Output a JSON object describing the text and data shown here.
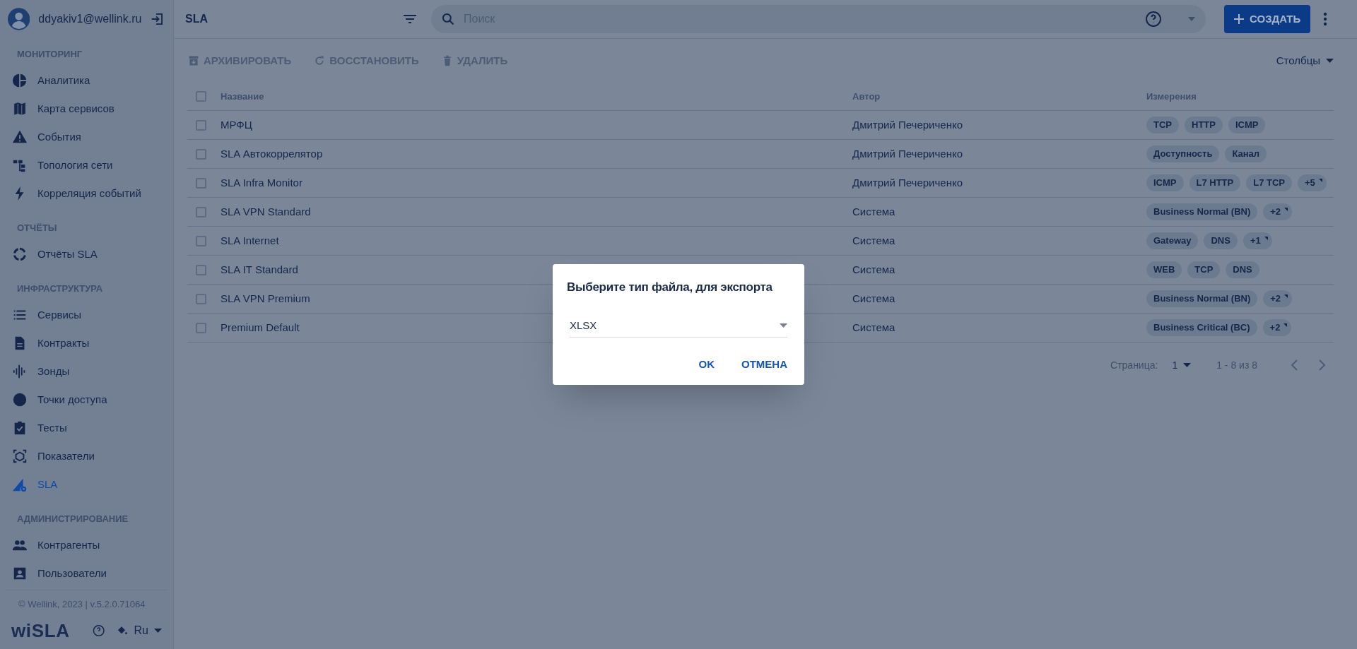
{
  "user": {
    "email": "ddyakiv1@wellink.ru"
  },
  "sidebar": {
    "sections": [
      {
        "heading": "МОНИТОРИНГ",
        "items": [
          {
            "label": "Аналитика",
            "selected": false
          },
          {
            "label": "Карта сервисов",
            "selected": false
          },
          {
            "label": "События",
            "selected": false
          },
          {
            "label": "Топология сети",
            "selected": false
          },
          {
            "label": "Корреляция событий",
            "selected": false
          }
        ]
      },
      {
        "heading": "ОТЧЁТЫ",
        "items": [
          {
            "label": "Отчёты SLA",
            "selected": false
          }
        ]
      },
      {
        "heading": "ИНФРАСТРУКТУРА",
        "items": [
          {
            "label": "Сервисы",
            "selected": false
          },
          {
            "label": "Контракты",
            "selected": false
          },
          {
            "label": "Зонды",
            "selected": false
          },
          {
            "label": "Точки доступа",
            "selected": false
          },
          {
            "label": "Тесты",
            "selected": false
          },
          {
            "label": "Показатели",
            "selected": false
          },
          {
            "label": "SLA",
            "selected": true
          }
        ]
      },
      {
        "heading": "АДМИНИСТРИРОВАНИЕ",
        "items": [
          {
            "label": "Контрагенты",
            "selected": false
          },
          {
            "label": "Пользователи",
            "selected": false
          }
        ]
      }
    ],
    "footer": "© Wellink, 2023 | v.5.2.0.71064",
    "logo": "wiSLA",
    "language": "Ru"
  },
  "header": {
    "title": "SLA",
    "search_placeholder": "Поиск",
    "create_button": "СОЗДАТЬ"
  },
  "toolbar": {
    "buttons": [
      "АРХИВИРОВАТЬ",
      "ВОССТАНОВИТЬ",
      "УДАЛИТЬ"
    ],
    "columns_button": "Столбцы"
  },
  "table": {
    "columns": [
      "Название",
      "Автор",
      "Измерения"
    ],
    "all_checked": false,
    "rows": [
      {
        "name": "МРФЦ",
        "author": "Дмитрий Печериченко",
        "checked": false,
        "tags": [
          {
            "label": "TCP",
            "kind": "tag"
          },
          {
            "label": "HTTP",
            "kind": "tag"
          },
          {
            "label": "ICMP",
            "kind": "tag"
          }
        ]
      },
      {
        "name": "SLA Автокоррелятор",
        "author": "Дмитрий Печериченко",
        "checked": false,
        "tags": [
          {
            "label": "Доступность",
            "kind": "tag"
          },
          {
            "label": "Канал",
            "kind": "tag"
          }
        ]
      },
      {
        "name": "SLA Infra Monitor",
        "author": "Дмитрий Печериченко",
        "checked": false,
        "tags": [
          {
            "label": "ICMP",
            "kind": "tag"
          },
          {
            "label": "L7 HTTP",
            "kind": "tag"
          },
          {
            "label": "L7 TCP",
            "kind": "tag"
          },
          {
            "label": "+5",
            "kind": "more"
          }
        ]
      },
      {
        "name": "SLA VPN Standard",
        "author": "Система",
        "checked": false,
        "tags": [
          {
            "label": "Business Normal (BN)",
            "kind": "tag"
          },
          {
            "label": "+2",
            "kind": "more"
          }
        ]
      },
      {
        "name": "SLA Internet",
        "author": "Система",
        "checked": false,
        "tags": [
          {
            "label": "Gateway",
            "kind": "tag"
          },
          {
            "label": "DNS",
            "kind": "tag"
          },
          {
            "label": "+1",
            "kind": "more"
          }
        ]
      },
      {
        "name": "SLA IT Standard",
        "author": "Система",
        "checked": false,
        "tags": [
          {
            "label": "WEB",
            "kind": "tag"
          },
          {
            "label": "TCP",
            "kind": "tag"
          },
          {
            "label": "DNS",
            "kind": "tag"
          }
        ]
      },
      {
        "name": "SLA VPN Premium",
        "author": "Система",
        "checked": false,
        "tags": [
          {
            "label": "Business Normal (BN)",
            "kind": "tag"
          },
          {
            "label": "+2",
            "kind": "more"
          }
        ]
      },
      {
        "name": "Premium Default",
        "author": "Система",
        "checked": false,
        "tags": [
          {
            "label": "Business Critical (BC)",
            "kind": "tag"
          },
          {
            "label": "+2",
            "kind": "more"
          }
        ]
      }
    ]
  },
  "pagination": {
    "label": "Страница:",
    "page": "1",
    "range": "1 - 8 из 8"
  },
  "dialog": {
    "title": "Выберите тип файла, для экспорта",
    "value": "XLSX",
    "buttons": [
      "OK",
      "ОТМЕНА"
    ]
  }
}
